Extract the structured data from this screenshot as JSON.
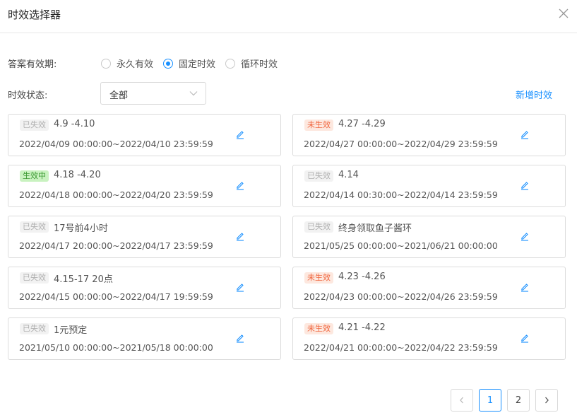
{
  "dialog": {
    "title": "时效选择器"
  },
  "validity": {
    "label": "答案有效期:",
    "options": [
      "永久有效",
      "固定时效",
      "循环时效"
    ],
    "selected": "固定时效"
  },
  "status_filter": {
    "label": "时效状态:",
    "value": "全部"
  },
  "add_label": "新增时效",
  "cards": [
    {
      "tag": "已失效",
      "name": "4.9 -4.10",
      "range": "2022/04/09 00:00:00~2022/04/10 23:59:59"
    },
    {
      "tag": "未生效",
      "name": "4.27 -4.29",
      "range": "2022/04/27 00:00:00~2022/04/29 23:59:59"
    },
    {
      "tag": "生效中",
      "name": "4.18 -4.20",
      "range": "2022/04/18 00:00:00~2022/04/20 23:59:59"
    },
    {
      "tag": "已失效",
      "name": "4.14",
      "range": "2022/04/14 00:30:00~2022/04/14 23:59:59"
    },
    {
      "tag": "已失效",
      "name": "17号前4小时",
      "range": "2022/04/17 20:00:00~2022/04/17 23:59:59"
    },
    {
      "tag": "已失效",
      "name": "终身领取鱼子酱环",
      "range": "2021/05/25 00:00:00~2021/06/21 00:00:00"
    },
    {
      "tag": "已失效",
      "name": "4.15-17 20点",
      "range": "2022/04/15 00:00:00~2022/04/17 19:59:59"
    },
    {
      "tag": "未生效",
      "name": "4.23 -4.26",
      "range": "2022/04/23 00:00:00~2022/04/26 23:59:59"
    },
    {
      "tag": "已失效",
      "name": "1元预定",
      "range": "2021/05/10 00:00:00~2021/05/18 00:00:00"
    },
    {
      "tag": "未生效",
      "name": "4.21 -4.22",
      "range": "2022/04/21 00:00:00~2022/04/22 23:59:59"
    }
  ],
  "pagination": {
    "pages": [
      "1",
      "2"
    ],
    "current": "1"
  },
  "colors": {
    "accent": "#1890ff",
    "pending": "#f0643c",
    "active": "#3c9a33",
    "expired": "#b0b0b0"
  },
  "icons": {
    "close": "close-icon",
    "edit": "edit-icon",
    "dropdown": "chevron-down-icon",
    "prev": "chevron-left-icon",
    "next": "chevron-right-icon"
  }
}
